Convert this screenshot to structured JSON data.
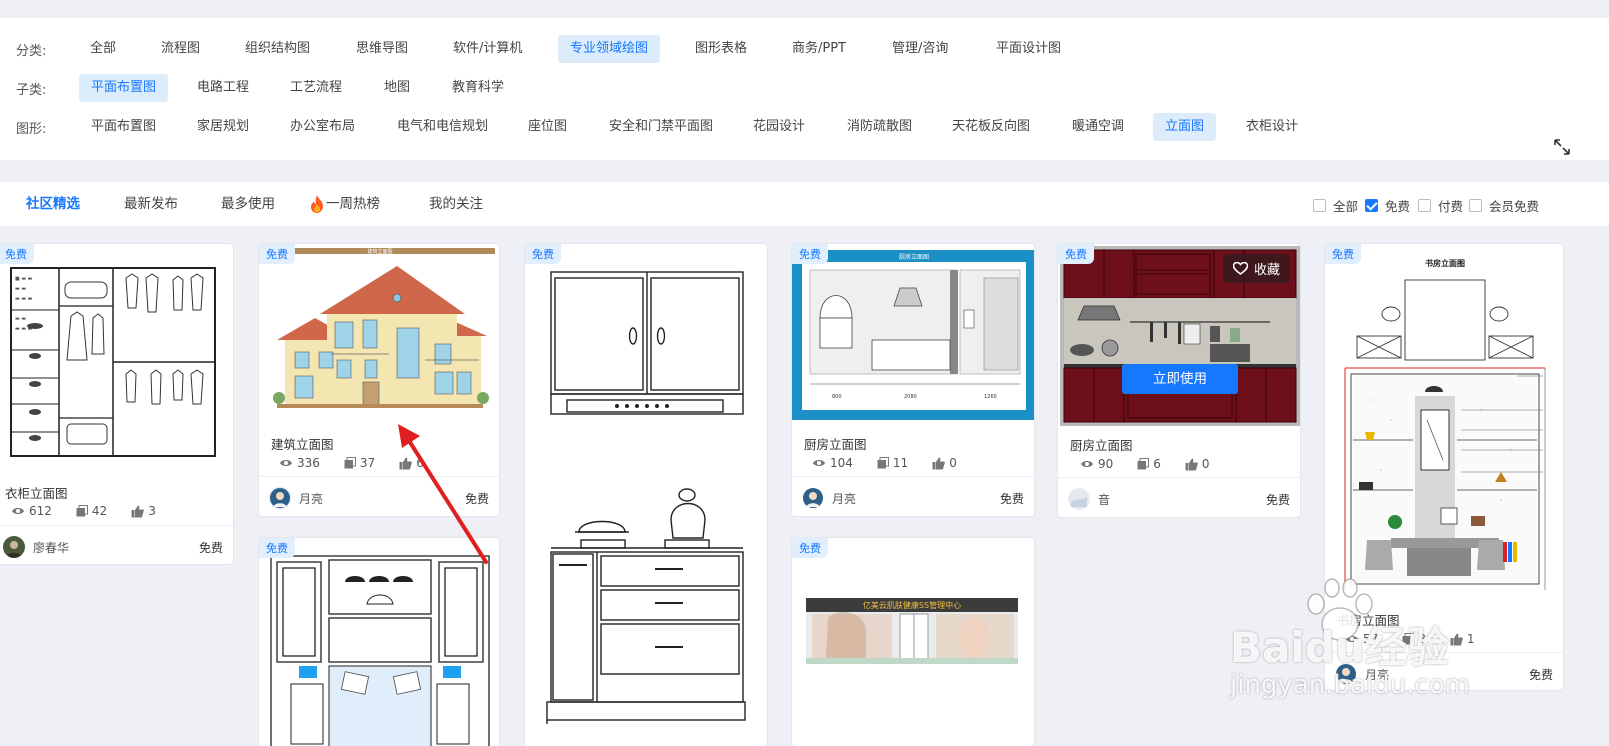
{
  "filters": {
    "category": {
      "label": "分类:",
      "items": [
        "全部",
        "流程图",
        "组织结构图",
        "思维导图",
        "软件/计算机",
        "专业领域绘图",
        "图形表格",
        "商务/PPT",
        "管理/咨询",
        "平面设计图"
      ],
      "active": "专业领域绘图"
    },
    "subcategory": {
      "label": "子类:",
      "items": [
        "平面布置图",
        "电路工程",
        "工艺流程",
        "地图",
        "教育科学"
      ],
      "active": "平面布置图"
    },
    "shape": {
      "label": "图形:",
      "items": [
        "平面布置图",
        "家居规划",
        "办公室布局",
        "电气和电信规划",
        "座位图",
        "安全和门禁平面图",
        "花园设计",
        "消防疏散图",
        "天花板反向图",
        "暖通空调",
        "立面图",
        "衣柜设计"
      ],
      "active": "立面图"
    }
  },
  "tabs": [
    "社区精选",
    "最新发布",
    "最多使用",
    "一周热榜",
    "我的关注"
  ],
  "active_tab": "社区精选",
  "price_filters": [
    {
      "label": "全部",
      "checked": false
    },
    {
      "label": "免费",
      "checked": true
    },
    {
      "label": "付费",
      "checked": false
    },
    {
      "label": "会员免费",
      "checked": false
    }
  ],
  "badge_free": "免费",
  "cards": [
    {
      "title": "衣柜立面图",
      "views": "612",
      "copies": "42",
      "likes": "3",
      "author": "廖春华",
      "price": "免费"
    },
    {
      "title": "建筑立面图",
      "views": "336",
      "copies": "37",
      "likes": "6",
      "author": "月亮",
      "price": "免费",
      "thumb_heading": "建筑立面图"
    },
    {
      "title": "厨房立面图",
      "views": "104",
      "copies": "11",
      "likes": "0",
      "author": "月亮",
      "price": "免费",
      "thumb_heading": "厨房立面图"
    },
    {
      "title": "厨房立面图",
      "views": "90",
      "copies": "6",
      "likes": "0",
      "author": "音",
      "price": "免费"
    },
    {
      "title": "书房立面图",
      "views": "57",
      "copies": "8",
      "likes": "1",
      "author": "月亮",
      "price": "免费",
      "thumb_heading": "书房立面图"
    }
  ],
  "hover": {
    "favorite_label": "收藏",
    "use_label": "立即使用"
  },
  "beauty_banner": "亿美云肌肤健康SS管理中心",
  "watermark": {
    "brand": "Baidu经验",
    "url": "jingyan.baidu.com"
  },
  "colors": {
    "accent": "#1677ff",
    "chip_active_bg": "#dcecfb",
    "badge_bg": "#e1effd",
    "arrow": "#e02020",
    "cabinet_red": "#6e0f1c"
  }
}
